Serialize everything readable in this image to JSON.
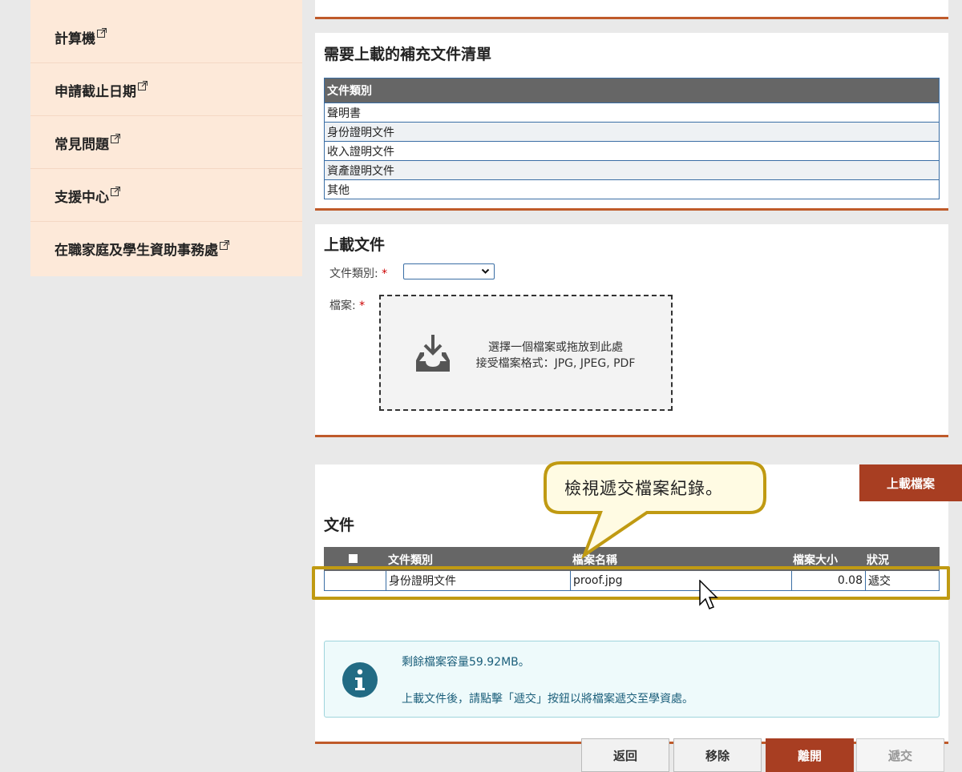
{
  "sidebar": {
    "items": [
      {
        "label": "計算機"
      },
      {
        "label": "申請截止日期"
      },
      {
        "label": "常見問題"
      },
      {
        "label": "支援中心"
      },
      {
        "label": "在職家庭及學生資助事務處"
      }
    ]
  },
  "required_docs": {
    "title": "需要上載的補充文件清單",
    "header": "文件類別",
    "rows": [
      "聲明書",
      "身份證明文件",
      "收入證明文件",
      "資產證明文件",
      "其他"
    ]
  },
  "upload": {
    "title": "上載文件",
    "doc_type_label": "文件類別:",
    "file_label": "檔案:",
    "required_mark": "*",
    "dropzone_line1": "選擇一個檔案或拖放到此處",
    "dropzone_line2": "接受檔案格式：JPG, JPEG, PDF"
  },
  "action_bar": {
    "upload_button": "上載檔案"
  },
  "files": {
    "title": "文件",
    "columns": [
      "文件類別",
      "檔案名稱",
      "檔案大小",
      "狀況"
    ],
    "rows": [
      {
        "doc_type": "身份證明文件",
        "file_name": "proof.jpg",
        "size": "0.08",
        "status": "遞交"
      }
    ]
  },
  "info": {
    "line1": "剩餘檔案容量59.92MB。",
    "line2": "上載文件後，請點擊「遞交」按鈕以將檔案遞交至學資處。"
  },
  "buttons": {
    "back": "返回",
    "remove": "移除",
    "leave": "離開",
    "submit": "遞交"
  },
  "callout": {
    "text": "檢視遞交檔案紀錄。"
  },
  "colors": {
    "accent": "#a83e22",
    "sidebar_bg": "#fde9d9",
    "callout_border": "#c09a12"
  }
}
